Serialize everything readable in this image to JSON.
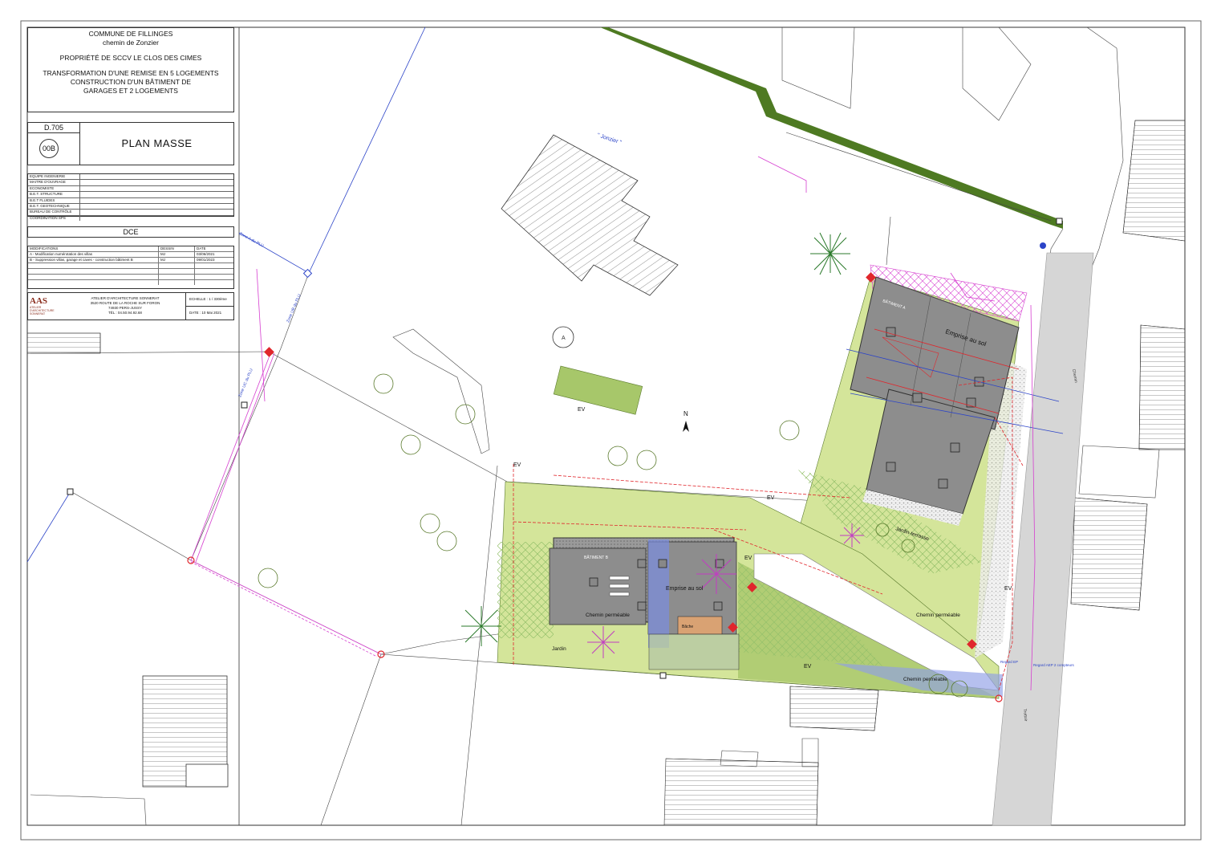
{
  "header": {
    "commune": "COMMUNE DE FILLINGES",
    "street": "chemin de Zonzier",
    "owner": "PROPRIÉTÉ DE SCCV LE CLOS DES CIMES",
    "project_line1": "TRANSFORMATION D'UNE REMISE EN 5 LOGEMENTS",
    "project_line2": "CONSTRUCTION D'UN BÂTIMENT DE GARAGES ET 2 LOGEMENTS"
  },
  "drawing": {
    "number": "D.705",
    "index": "00B",
    "title": "PLAN MASSE"
  },
  "team": [
    "EQUIPE INGENIERIE",
    "MAITRE D'OUVRAGE",
    "ECONOMISTE",
    "B.E.T. STRUCTURE",
    "B.E.T FLUIDES",
    "B.E.T. GEOTECHNIQUE",
    "BUREAU DE CONTRÔLE",
    "COORDINATION SPS"
  ],
  "phase": "DCE",
  "modifications": {
    "headers": [
      "MODIFICATIONS",
      "DESSIN",
      "DATE"
    ],
    "rows": [
      [
        "A - Modification numérotation des villas",
        "MJ",
        "03/06/2021"
      ],
      [
        "B - Suppression villas, garage et caves - construction bâtiment B",
        "MJ",
        "09/01/2023"
      ]
    ]
  },
  "architect": {
    "logo_text": "AAS",
    "logo_sub": "ATELIER D'ARCHITECTURE SONNERAT",
    "name": "ATELIER D'ARCHITECTURE SONNERAT",
    "address": "3520 ROUTE DE LA ROCHE SUR FORON",
    "city": "74930 PERS-JUSSY",
    "phone": "TÉL : 04.50.94.92.68",
    "scale": "ECHELLE : 1 / 330ème",
    "date": "DATE : 10 Mai 2021"
  },
  "plan": {
    "road_name": "\" Jonzier \"",
    "north": "N",
    "label_A": "A",
    "building_a": "BÂTIMENT A",
    "building_b": "BÂTIMENT B",
    "footprint_a": "Emprise au sol",
    "footprint_b": "Emprise au sol",
    "ev_labels": [
      "EV",
      "EV",
      "EV",
      "EV",
      "EV",
      "EV"
    ],
    "chemin_permeable_1": "Chemin perméable",
    "chemin_permeable_2": "Chemin perméable",
    "chemin_permeable_3": "Chemin perméable",
    "jardin_terrasse": "Jardin-terrasse",
    "jardin": "Jardin",
    "zone_a": "Zone A du PLU",
    "zone_ub": "Zone UB du PLU",
    "zone_uc": "Zone UC du PLU",
    "chemin": "Chemin",
    "trottoir": "Trottoir",
    "bache": "Bâche",
    "regard_ep": "Regard EP",
    "regard_ep_2": "Regard AEP 2 compteurs"
  },
  "colors": {
    "green_band": "#4e7a22",
    "lawn": "#d4e59a",
    "lawn_dark": "#a7c76a",
    "roof": "#8d8d8d",
    "magenta": "#d63fd0",
    "red": "#e0262c",
    "blue": "#2c44c8",
    "road": "#d6d6d6"
  }
}
